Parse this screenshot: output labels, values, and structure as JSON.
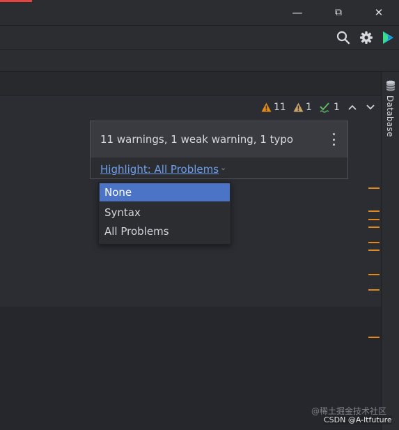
{
  "window_controls": {
    "minimize": "—",
    "restore": "⧉",
    "close": "✕"
  },
  "toolbar": {
    "icons": [
      "search-icon",
      "gear-icon",
      "ai-assistant-icon"
    ]
  },
  "right_panel": {
    "label": "Database",
    "icon": "database-icon"
  },
  "inspections": {
    "warnings_count": "11",
    "weak_warnings_count": "1",
    "typos_count": "1",
    "colors": {
      "warning": "#e08a1a",
      "weak_warning": "#c8a36b",
      "typo": "#5fb865"
    }
  },
  "popup": {
    "summary": "11 warnings, 1 weak warning, 1 typo",
    "highlight_label": "Highlight: All Problems",
    "highlight_chevron": "⌄"
  },
  "dropdown": {
    "options": [
      "None",
      "Syntax",
      "All Problems"
    ],
    "selected": "None",
    "selected_color": "#4b73c6"
  },
  "error_stripe": {
    "color": "#e08a1a",
    "marks": 9
  },
  "watermark": {
    "line1": "@稀土掘金技术社区",
    "line2": "CSDN @A-ltfuture"
  }
}
